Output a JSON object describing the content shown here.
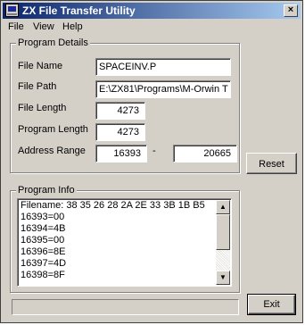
{
  "window": {
    "title": "ZX File Transfer Utility",
    "close_glyph": "×"
  },
  "menu": {
    "items": [
      "File",
      "View",
      "Help"
    ]
  },
  "details": {
    "title": "Program Details",
    "file_name_label": "File Name",
    "file_name": "SPACEINV.P",
    "file_path_label": "File Path",
    "file_path": "E:\\ZX81\\Programs\\M-Orwin T",
    "file_length_label": "File Length",
    "file_length": "4273",
    "program_length_label": "Program Length",
    "program_length": "4273",
    "address_range_label": "Address Range",
    "address_start": "16393",
    "address_separator": "-",
    "address_end": "20665"
  },
  "buttons": {
    "reset": "Reset",
    "exit": "Exit"
  },
  "info": {
    "title": "Program Info",
    "lines": [
      "Filename: 38 35 26 28 2A 2E 33 3B 1B B5",
      "16393=00",
      "16394=4B",
      "16395=00",
      "16396=8E",
      "16397=4D",
      "16398=8F"
    ]
  },
  "scroll": {
    "up_glyph": "▲",
    "down_glyph": "▼"
  },
  "progress": {
    "fraction": 0
  }
}
